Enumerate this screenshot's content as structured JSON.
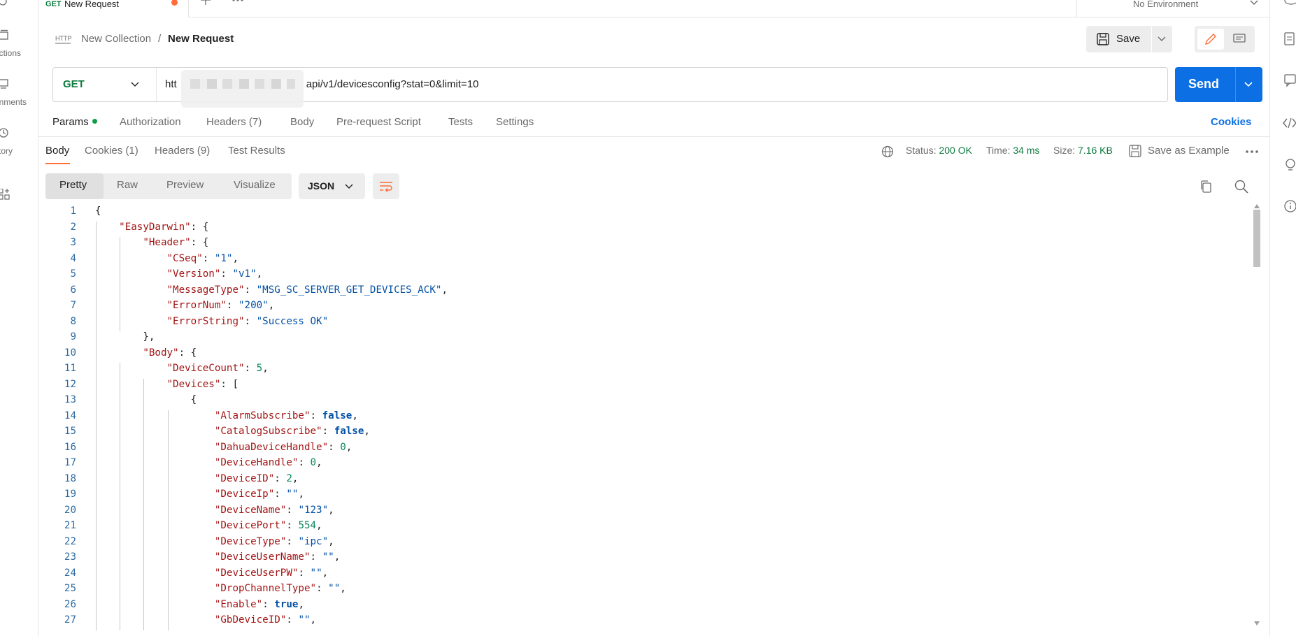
{
  "sidebar_left": {
    "items": [
      {
        "label": "ections",
        "icon": "collections-icon"
      },
      {
        "label": "onments",
        "icon": "environments-icon"
      },
      {
        "label": "story",
        "icon": "history-icon"
      },
      {
        "label": "",
        "icon": "add-apps-icon"
      }
    ]
  },
  "tabs": {
    "active": {
      "method": "GET",
      "name": "New Request"
    },
    "environment": "No Environment"
  },
  "header": {
    "collection": "New Collection",
    "separator": "/",
    "request_name": "New Request",
    "save_label": "Save"
  },
  "request": {
    "method": "GET",
    "url_prefix": "htt",
    "url_suffix": "api/v1/devicesconfig?stat=0&limit=10",
    "send_label": "Send"
  },
  "request_tabs": {
    "params": "Params",
    "authorization": "Authorization",
    "headers": "Headers (7)",
    "body": "Body",
    "prerequest": "Pre-request Script",
    "tests": "Tests",
    "settings": "Settings",
    "cookies": "Cookies"
  },
  "response_tabs": {
    "body": "Body",
    "cookies": "Cookies (1)",
    "headers": "Headers (9)",
    "test_results": "Test Results"
  },
  "response_status": {
    "status_label": "Status:",
    "status_value": "200 OK",
    "time_label": "Time:",
    "time_value": "34 ms",
    "size_label": "Size:",
    "size_value": "7.16 KB",
    "save_example": "Save as Example"
  },
  "view": {
    "modes": [
      "Pretty",
      "Raw",
      "Preview",
      "Visualize"
    ],
    "active_mode": "Pretty",
    "format": "JSON"
  },
  "colors": {
    "accent": "#ff6c37",
    "send": "#0c6fe4",
    "get_method": "#0b7a3e"
  },
  "code_lines": [
    {
      "n": "1",
      "t": "{"
    },
    {
      "n": "2",
      "t": "    \"EasyDarwin\": {"
    },
    {
      "n": "3",
      "t": "        \"Header\": {"
    },
    {
      "n": "4",
      "t": "            \"CSeq\": \"1\","
    },
    {
      "n": "5",
      "t": "            \"Version\": \"v1\","
    },
    {
      "n": "6",
      "t": "            \"MessageType\": \"MSG_SC_SERVER_GET_DEVICES_ACK\","
    },
    {
      "n": "7",
      "t": "            \"ErrorNum\": \"200\","
    },
    {
      "n": "8",
      "t": "            \"ErrorString\": \"Success OK\""
    },
    {
      "n": "9",
      "t": "        },"
    },
    {
      "n": "10",
      "t": "        \"Body\": {"
    },
    {
      "n": "11",
      "t": "            \"DeviceCount\": 5,"
    },
    {
      "n": "12",
      "t": "            \"Devices\": ["
    },
    {
      "n": "13",
      "t": "                {"
    },
    {
      "n": "14",
      "t": "                    \"AlarmSubscribe\": false,"
    },
    {
      "n": "15",
      "t": "                    \"CatalogSubscribe\": false,"
    },
    {
      "n": "16",
      "t": "                    \"DahuaDeviceHandle\": 0,"
    },
    {
      "n": "17",
      "t": "                    \"DeviceHandle\": 0,"
    },
    {
      "n": "18",
      "t": "                    \"DeviceID\": 2,"
    },
    {
      "n": "19",
      "t": "                    \"DeviceIp\": \"\","
    },
    {
      "n": "20",
      "t": "                    \"DeviceName\": \"123\","
    },
    {
      "n": "21",
      "t": "                    \"DevicePort\": 554,"
    },
    {
      "n": "22",
      "t": "                    \"DeviceType\": \"ipc\","
    },
    {
      "n": "23",
      "t": "                    \"DeviceUserName\": \"\","
    },
    {
      "n": "24",
      "t": "                    \"DeviceUserPW\": \"\","
    },
    {
      "n": "25",
      "t": "                    \"DropChannelType\": \"\","
    },
    {
      "n": "26",
      "t": "                    \"Enable\": true,"
    },
    {
      "n": "27",
      "t": "                    \"GbDeviceID\": \"\","
    }
  ]
}
